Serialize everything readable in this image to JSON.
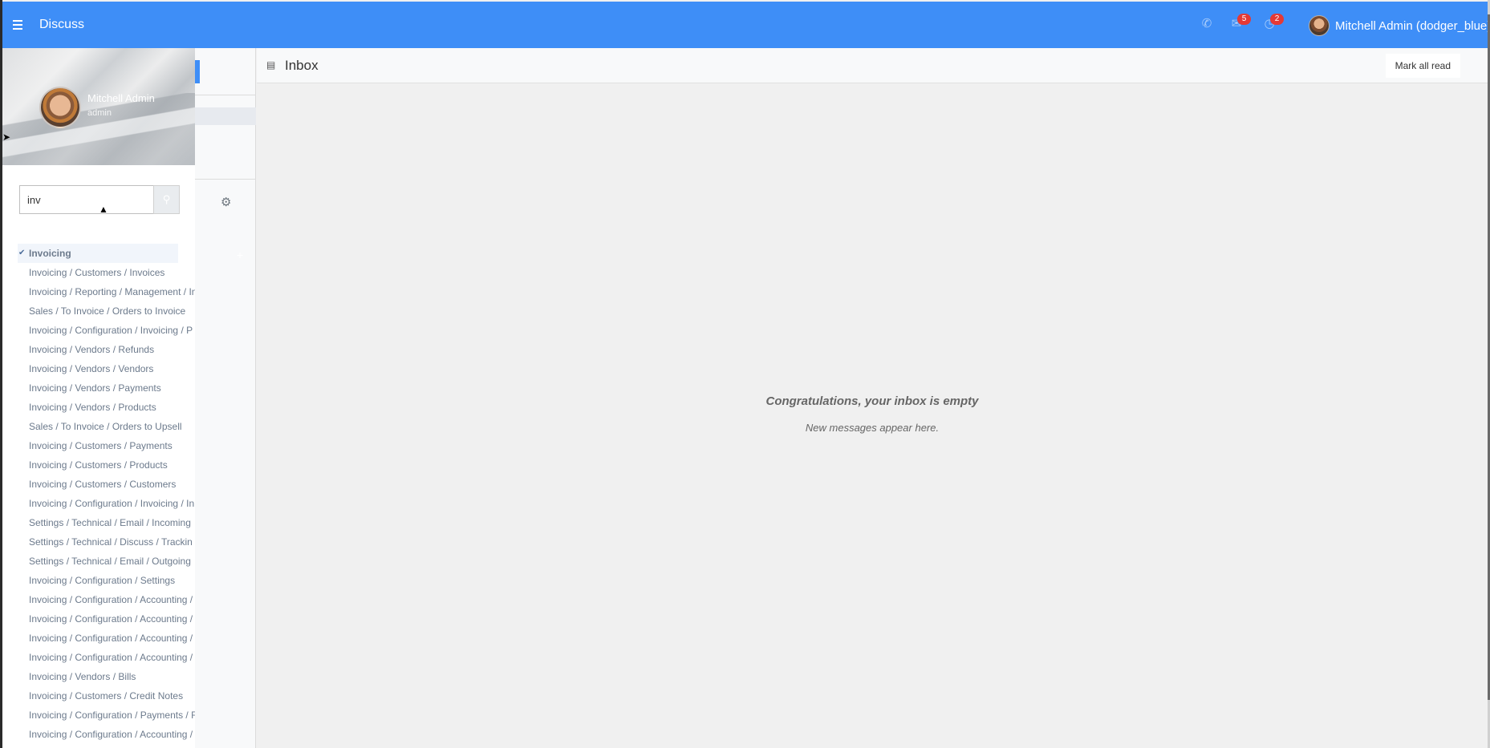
{
  "navbar": {
    "title": "Discuss",
    "activity_badge": "5",
    "messages_badge": "2",
    "user_name": "Mitchell Admin (dodger_blue)"
  },
  "main": {
    "inbox_title": "Inbox",
    "mark_all_read": "Mark all read",
    "empty_title": "Congratulations, your inbox is empty",
    "empty_subtitle": "New messages appear here."
  },
  "drawer": {
    "user_name": "Mitchell Admin",
    "user_login": "admin",
    "search_value": "inv",
    "results": [
      "Invoicing",
      "Invoicing / Customers / Invoices",
      "Invoicing / Reporting / Management / In",
      "Sales / To Invoice / Orders to Invoice",
      "Invoicing / Configuration / Invoicing / P",
      "Invoicing / Vendors / Refunds",
      "Invoicing / Vendors / Vendors",
      "Invoicing / Vendors / Payments",
      "Invoicing / Vendors / Products",
      "Sales / To Invoice / Orders to Upsell",
      "Invoicing / Customers / Payments",
      "Invoicing / Customers / Products",
      "Invoicing / Customers / Customers",
      "Invoicing / Configuration / Invoicing / In",
      "Settings / Technical / Email / Incoming",
      "Settings / Technical / Discuss / Trackin",
      "Settings / Technical / Email / Outgoing",
      "Invoicing / Configuration / Settings",
      "Invoicing / Configuration / Accounting /",
      "Invoicing / Configuration / Accounting /",
      "Invoicing / Configuration / Accounting /",
      "Invoicing / Configuration / Accounting /",
      "Invoicing / Vendors / Bills",
      "Invoicing / Customers / Credit Notes",
      "Invoicing / Configuration / Payments / F",
      "Invoicing / Configuration / Accounting /"
    ]
  },
  "colors": {
    "navbar": "#3e8ef7",
    "badge": "#e53935"
  },
  "icons": [
    "menu-icon",
    "phone-icon",
    "comments-icon",
    "clock-icon",
    "gear-icon",
    "plus-icon",
    "inbox-icon",
    "search-icon",
    "check-icon"
  ]
}
